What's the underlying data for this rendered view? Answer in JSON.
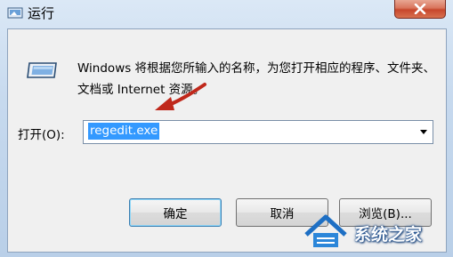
{
  "window": {
    "title": "运行",
    "close_icon": "close-icon"
  },
  "main": {
    "description": "Windows 将根据您所输入的名称，为您打开相应的程序、文件夹、文档或 Internet 资源。",
    "open_label": "打开(O):",
    "command_value": "regedit.exe"
  },
  "buttons": {
    "ok": "确定",
    "cancel": "取消",
    "browse": "浏览(B)..."
  },
  "watermark": {
    "text": "系统之家"
  },
  "colors": {
    "selection": "#3399ff",
    "annotation_arrow": "#c0281b"
  }
}
